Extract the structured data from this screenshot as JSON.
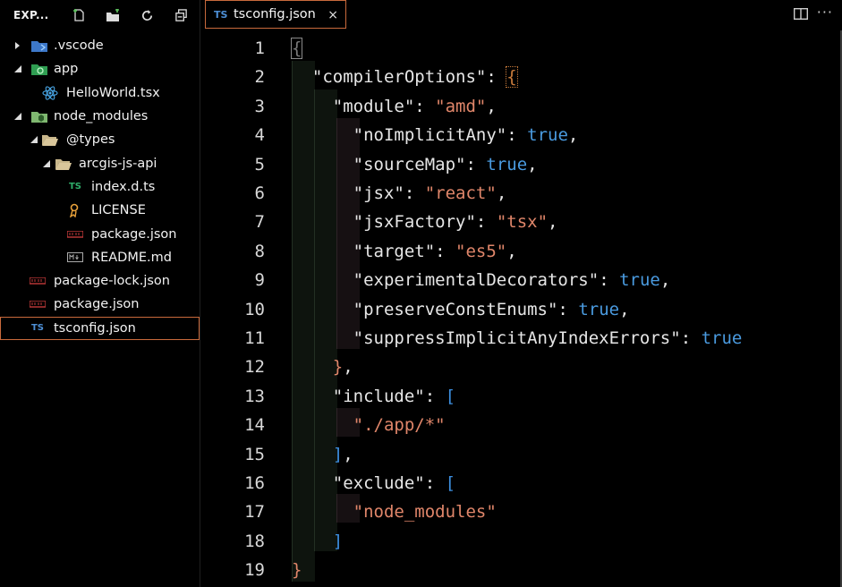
{
  "explorer": {
    "title": "EXP...",
    "tree": [
      {
        "label": ".vscode",
        "icon": "folder-vscode-icon",
        "indent": 0,
        "chevron": "right"
      },
      {
        "label": "app",
        "icon": "folder-app-icon",
        "indent": 0,
        "chevron": "down"
      },
      {
        "label": "HelloWorld.tsx",
        "icon": "react-icon",
        "indent": 1,
        "chevron": ""
      },
      {
        "label": "node_modules",
        "icon": "folder-node-icon",
        "indent": 0,
        "chevron": "down"
      },
      {
        "label": "@types",
        "icon": "folder-open-icon",
        "indent": 1,
        "chevron": "down"
      },
      {
        "label": "arcgis-js-api",
        "icon": "folder-open-icon",
        "indent": 2,
        "chevron": "down"
      },
      {
        "label": "index.d.ts",
        "icon": "typescript-def-icon",
        "indent": 3,
        "chevron": ""
      },
      {
        "label": "LICENSE",
        "icon": "license-icon",
        "indent": 3,
        "chevron": ""
      },
      {
        "label": "package.json",
        "icon": "npm-icon",
        "indent": 3,
        "chevron": ""
      },
      {
        "label": "README.md",
        "icon": "markdown-icon",
        "indent": 3,
        "chevron": ""
      },
      {
        "label": "package-lock.json",
        "icon": "npm-icon",
        "indent": 0,
        "chevron": ""
      },
      {
        "label": "package.json",
        "icon": "npm-icon",
        "indent": 0,
        "chevron": ""
      },
      {
        "label": "tsconfig.json",
        "icon": "tsconfig-icon",
        "indent": 0,
        "chevron": "",
        "selected": true
      }
    ]
  },
  "tab": {
    "icon_text": "TS",
    "name": "tsconfig.json",
    "close": "×"
  },
  "editor": {
    "line_numbers": [
      "1",
      "2",
      "3",
      "4",
      "5",
      "6",
      "7",
      "8",
      "9",
      "10",
      "11",
      "12",
      "13",
      "14",
      "15",
      "16",
      "17",
      "18",
      "19"
    ],
    "lines": [
      [
        {
          "t": "{",
          "c": "cursorbr"
        }
      ],
      [
        {
          "t": "  ",
          "c": "p"
        },
        {
          "t": "\"compilerOptions\"",
          "c": "k"
        },
        {
          "t": ": ",
          "c": "p"
        },
        {
          "t": "{",
          "c": "bh"
        }
      ],
      [
        {
          "t": "    ",
          "c": "p"
        },
        {
          "t": "\"module\"",
          "c": "k"
        },
        {
          "t": ": ",
          "c": "p"
        },
        {
          "t": "\"amd\"",
          "c": "s"
        },
        {
          "t": ",",
          "c": "p"
        }
      ],
      [
        {
          "t": "      ",
          "c": "p"
        },
        {
          "t": "\"noImplicitAny\"",
          "c": "k"
        },
        {
          "t": ": ",
          "c": "p"
        },
        {
          "t": "true",
          "c": "b"
        },
        {
          "t": ",",
          "c": "p"
        }
      ],
      [
        {
          "t": "      ",
          "c": "p"
        },
        {
          "t": "\"sourceMap\"",
          "c": "k"
        },
        {
          "t": ": ",
          "c": "p"
        },
        {
          "t": "true",
          "c": "b"
        },
        {
          "t": ",",
          "c": "p"
        }
      ],
      [
        {
          "t": "      ",
          "c": "p"
        },
        {
          "t": "\"jsx\"",
          "c": "k"
        },
        {
          "t": ": ",
          "c": "p"
        },
        {
          "t": "\"react\"",
          "c": "s"
        },
        {
          "t": ",",
          "c": "p"
        }
      ],
      [
        {
          "t": "      ",
          "c": "p"
        },
        {
          "t": "\"jsxFactory\"",
          "c": "k"
        },
        {
          "t": ": ",
          "c": "p"
        },
        {
          "t": "\"tsx\"",
          "c": "s"
        },
        {
          "t": ",",
          "c": "p"
        }
      ],
      [
        {
          "t": "      ",
          "c": "p"
        },
        {
          "t": "\"target\"",
          "c": "k"
        },
        {
          "t": ": ",
          "c": "p"
        },
        {
          "t": "\"es5\"",
          "c": "s"
        },
        {
          "t": ",",
          "c": "p"
        }
      ],
      [
        {
          "t": "      ",
          "c": "p"
        },
        {
          "t": "\"experimentalDecorators\"",
          "c": "k"
        },
        {
          "t": ": ",
          "c": "p"
        },
        {
          "t": "true",
          "c": "b"
        },
        {
          "t": ",",
          "c": "p"
        }
      ],
      [
        {
          "t": "      ",
          "c": "p"
        },
        {
          "t": "\"preserveConstEnums\"",
          "c": "k"
        },
        {
          "t": ": ",
          "c": "p"
        },
        {
          "t": "true",
          "c": "b"
        },
        {
          "t": ",",
          "c": "p"
        }
      ],
      [
        {
          "t": "      ",
          "c": "p"
        },
        {
          "t": "\"suppressImplicitAnyIndexErrors\"",
          "c": "k"
        },
        {
          "t": ": ",
          "c": "p"
        },
        {
          "t": "true",
          "c": "b"
        }
      ],
      [
        {
          "t": "    ",
          "c": "p"
        },
        {
          "t": "}",
          "c": "s"
        },
        {
          "t": ",",
          "c": "p"
        }
      ],
      [
        {
          "t": "    ",
          "c": "p"
        },
        {
          "t": "\"include\"",
          "c": "k"
        },
        {
          "t": ": ",
          "c": "p"
        },
        {
          "t": "[",
          "c": "br"
        }
      ],
      [
        {
          "t": "      ",
          "c": "p"
        },
        {
          "t": "\"./app/*\"",
          "c": "s"
        }
      ],
      [
        {
          "t": "    ",
          "c": "p"
        },
        {
          "t": "]",
          "c": "br"
        },
        {
          "t": ",",
          "c": "p"
        }
      ],
      [
        {
          "t": "    ",
          "c": "p"
        },
        {
          "t": "\"exclude\"",
          "c": "k"
        },
        {
          "t": ": ",
          "c": "p"
        },
        {
          "t": "[",
          "c": "br"
        }
      ],
      [
        {
          "t": "      ",
          "c": "p"
        },
        {
          "t": "\"node_modules\"",
          "c": "s"
        }
      ],
      [
        {
          "t": "    ",
          "c": "p"
        },
        {
          "t": "]",
          "c": "br"
        }
      ],
      [
        {
          "t": "}",
          "c": "s"
        }
      ]
    ]
  },
  "colors": {
    "accent": "#c96a3c",
    "keyword": "#e6e6e6",
    "string": "#e0866a",
    "boolean": "#4a9be0"
  }
}
